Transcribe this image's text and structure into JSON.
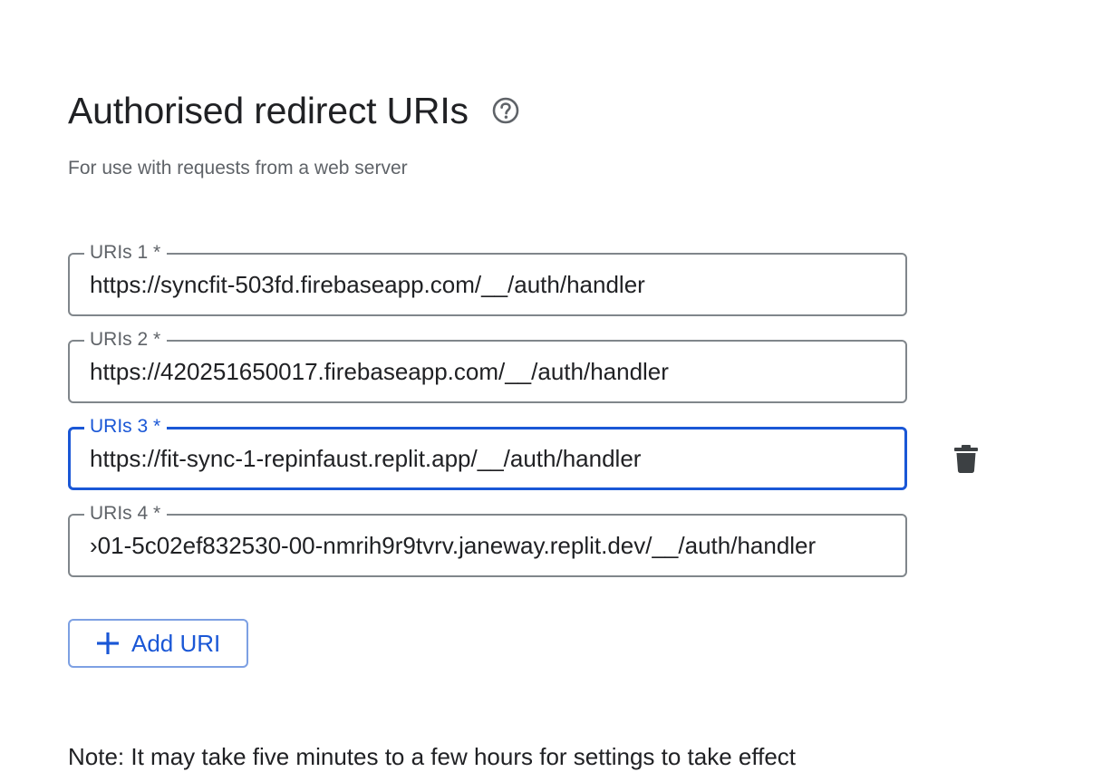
{
  "section": {
    "title": "Authorised redirect URIs",
    "subtitle": "For use with requests from a web server",
    "help_icon": "help-circle-icon"
  },
  "uris": [
    {
      "label": "URIs 1 *",
      "value": "https://syncfit-503fd.firebaseapp.com/__/auth/handler",
      "focused": false
    },
    {
      "label": "URIs 2 *",
      "value": "https://420251650017.firebaseapp.com/__/auth/handler",
      "focused": false
    },
    {
      "label": "URIs 3 *",
      "value": "https://fit-sync-1-repinfaust.replit.app/__/auth/handler",
      "focused": true
    },
    {
      "label": "URIs 4 *",
      "value": "›01-5c02ef832530-00-nmrih9r9tvrv.janeway.replit.dev/__/auth/handler",
      "focused": false
    }
  ],
  "delete_icon": "trash-icon",
  "add_button": {
    "label": "Add URI",
    "icon": "plus-icon"
  },
  "note": "Note: It may take five minutes to a few hours for settings to take effect",
  "colors": {
    "accent": "#1a57d6",
    "border": "#80868b",
    "secondary_text": "#5f6368",
    "primary_text": "#202124"
  }
}
